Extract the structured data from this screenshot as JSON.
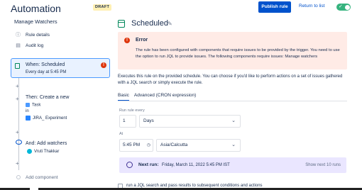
{
  "header": {
    "title": "Automation",
    "draft_badge": "DRAFT",
    "publish_label": "Publish rule",
    "return_label": "Return to list",
    "toggle_check": "✓"
  },
  "sidebar": {
    "heading": "Manage Watchers",
    "items": [
      {
        "label": "Rule details",
        "icon": "info-icon"
      },
      {
        "label": "Audit log",
        "icon": "audit-log-icon"
      }
    ],
    "trigger": {
      "title": "When: Scheduled",
      "subtitle": "Every day at 5:45 PM",
      "error_mark": "!"
    },
    "action1": {
      "title": "Then: Create a new",
      "issue_type": "Task",
      "in": "in",
      "project": "JIRA_ Experiment"
    },
    "action2": {
      "title": "And: Add watchers",
      "user": "Vruti Thakkar"
    },
    "add_component": "Add component"
  },
  "main": {
    "heading": "Scheduled",
    "error": {
      "mark": "!",
      "title": "Error",
      "body": "The rule has been configured with components that require issues to be provided by the trigger. You need to use the option to run JQL to provide issues. The following components require issues: Manage watchers"
    },
    "description": "Executes this rule on the provided schedule. You can choose if you'd like to perform actions on a set of issues gathered with a JQL search or simply execute the rule.",
    "tabs": [
      "Basic",
      "Advanced (CRON expression)"
    ],
    "run_every": {
      "label": "Run rule every",
      "value": "1",
      "unit": "Days"
    },
    "at": {
      "label": "At",
      "time": "5:45 PM",
      "timezone": "Asia/Calcutta"
    },
    "next_run": {
      "label": "Next run:",
      "value": "Friday, March 11, 2022 5:45 PM IST",
      "more": "Show next 10 runs"
    },
    "jql_option": "run a JQL search and pass results to subsequent conditions and actions"
  }
}
